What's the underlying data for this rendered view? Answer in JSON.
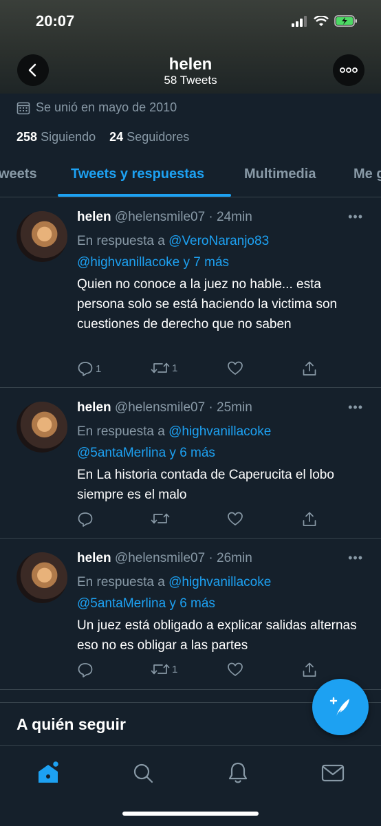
{
  "status_bar": {
    "time": "20:07"
  },
  "header": {
    "name": "helen",
    "tweet_count": "58 Tweets"
  },
  "profile": {
    "joined": "Se unió en mayo de 2010",
    "following_count": "258",
    "following_label": "Siguiendo",
    "followers_count": "24",
    "followers_label": "Seguidores"
  },
  "tabs": [
    {
      "label": "weets"
    },
    {
      "label": "Tweets y respuestas",
      "active": true
    },
    {
      "label": "Multimedia"
    },
    {
      "label": "Me g"
    }
  ],
  "tweets": [
    {
      "name": "helen",
      "handle": "@helensmile07 · 24min",
      "reply_prefix": "En respuesta a",
      "reply_user1": "@VeroNaranjo83",
      "reply_user2": "@highvanillacoke y 7 más",
      "text": "Quien no conoce a la juez no hable... esta persona solo se está haciendo la victima son cuestiones de derecho que no saben",
      "replies": "1",
      "retweets": "1",
      "likes": ""
    },
    {
      "name": "helen",
      "handle": "@helensmile07 · 25min",
      "reply_prefix": "En respuesta a",
      "reply_user1": "@highvanillacoke",
      "reply_user2": "@5antaMerlina y 6 más",
      "text": "En La historia contada de Caperucita el lobo siempre es el malo",
      "replies": "",
      "retweets": "",
      "likes": ""
    },
    {
      "name": "helen",
      "handle": "@helensmile07 · 26min",
      "reply_prefix": "En respuesta a",
      "reply_user1": "@highvanillacoke",
      "reply_user2": "@5antaMerlina y 6 más",
      "text": "Un juez está obligado a explicar salidas alternas eso no es obligar a las partes",
      "replies": "",
      "retweets": "1",
      "likes": ""
    }
  ],
  "who_to_follow": "A quién seguir",
  "icons": {
    "back": "chevron-left-icon",
    "more": "more-horizontal-icon",
    "calendar": "calendar-icon",
    "reply": "reply-icon",
    "retweet": "retweet-icon",
    "like": "heart-icon",
    "share": "share-icon",
    "compose": "compose-feather-icon",
    "home": "home-icon",
    "search": "search-icon",
    "notifications": "bell-icon",
    "messages": "mail-icon"
  },
  "colors": {
    "accent": "#1da1f2",
    "background": "#15202b",
    "secondary_text": "#8899a6"
  }
}
